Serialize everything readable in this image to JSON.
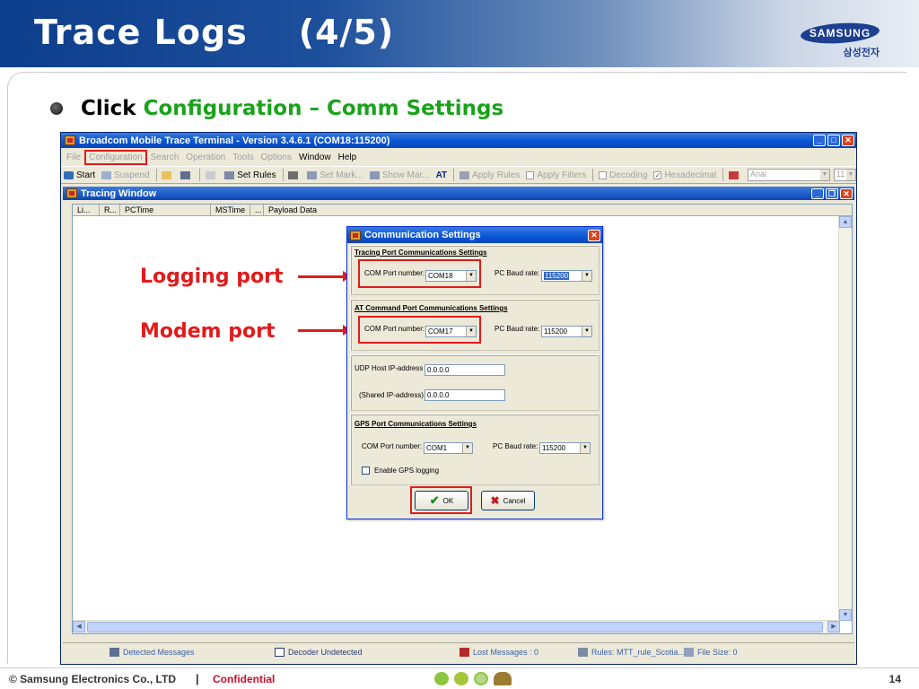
{
  "slide": {
    "title": "Trace Logs    (4/5)",
    "logo_text": "SAMSUNG",
    "logo_sub": "삼성전자",
    "bullet_prefix": "Click",
    "bullet_highlight": "Configuration – Comm Settings"
  },
  "annotations": {
    "logging_port": "Logging port",
    "modem_port": "Modem port"
  },
  "app": {
    "title": "Broadcom Mobile Trace Terminal - Version 3.4.6.1 (COM18:115200)",
    "menu": [
      "File",
      "Configuration",
      "Search",
      "Operation",
      "Tools",
      "Options",
      "Window",
      "Help"
    ],
    "toolbar": {
      "start": "Start",
      "suspend": "Suspend",
      "set_rules": "Set Rules",
      "set_mark": "Set Mark...",
      "show_mark": "Show Mar...",
      "at": "AT",
      "apply_rules": "Apply Rules",
      "apply_filters": "Apply Filters",
      "decoding": "Decoding",
      "hexadecimal": "Hexadecimal",
      "font": "Arial",
      "font_size": "11"
    },
    "tracing_window": {
      "title": "Tracing Window",
      "columns": [
        "Li...",
        "R...",
        "PCTime",
        "MSTime",
        "...",
        "Payload Data"
      ]
    },
    "status": {
      "detected": "Detected Messages",
      "decoder": "Decoder Undetected",
      "lost": "Lost Messages : 0",
      "rules": "Rules: MTT_rule_Scotia...",
      "file_size": "File Size: 0"
    }
  },
  "dialog": {
    "title": "Communication Settings",
    "tracing": {
      "heading": "Tracing Port Communications Settings",
      "com_label": "COM Port number:",
      "com_value": "COM18",
      "baud_label": "PC Baud rate:",
      "baud_value": "115200"
    },
    "at": {
      "heading": "AT Command Port Communications Settings",
      "com_label": "COM Port number:",
      "com_value": "COM17",
      "baud_label": "PC Baud rate:",
      "baud_value": "115200"
    },
    "udp": {
      "host_label": "UDP Host IP-address",
      "host_value": "0.0.0.0",
      "shared_label": "(Shared IP-address)",
      "shared_value": "0.0.0.0"
    },
    "gps": {
      "heading": "GPS Port Communications Settings",
      "com_label": "COM Port number:",
      "com_value": "COM1",
      "baud_label": "PC Baud rate:",
      "baud_value": "115200",
      "enable_label": "Enable GPS logging"
    },
    "ok": "OK",
    "cancel": "Cancel"
  },
  "footer": {
    "copyright": "© Samsung Electronics Co., LTD",
    "separator": "|",
    "confidential": "Confidential",
    "page": "14"
  },
  "colors": {
    "accent_red": "#e21b1b",
    "highlight_green": "#1aa31a",
    "xp_blue": "#0a58d6",
    "confidential": "#c8102e"
  }
}
